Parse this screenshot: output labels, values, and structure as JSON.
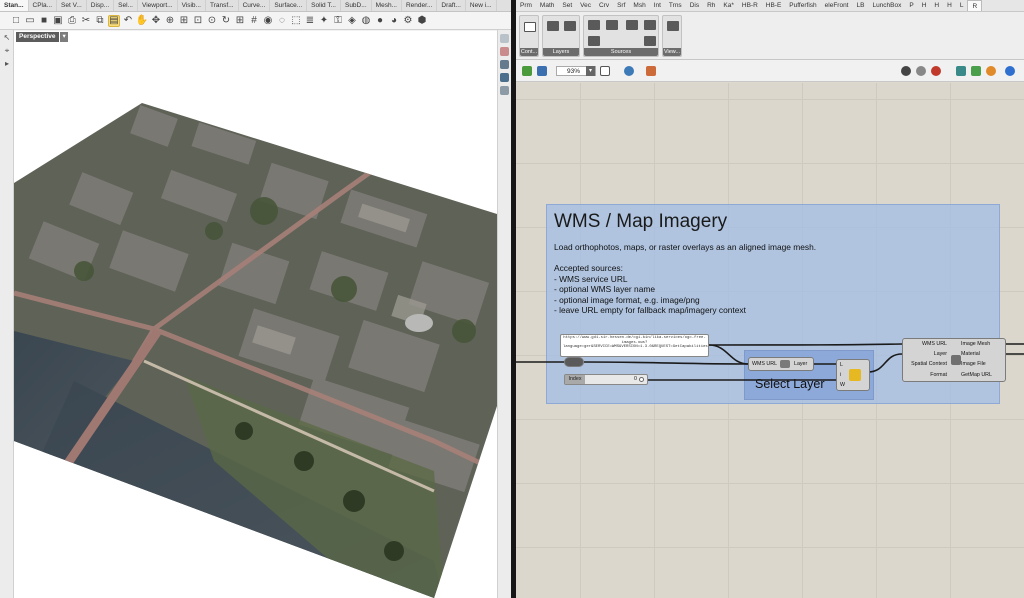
{
  "rhino": {
    "tabs": [
      "Stan...",
      "CPla...",
      "Set V...",
      "Disp...",
      "Sel...",
      "Viewport...",
      "Visib...",
      "Transf...",
      "Curve...",
      "Surface...",
      "Solid T...",
      "SubD...",
      "Mesh...",
      "Render...",
      "Draft...",
      "New i..."
    ],
    "active_tab": 0,
    "toolbar_icons": [
      "new-file-icon",
      "open-folder-icon",
      "save-icon",
      "print-icon",
      "import-icon",
      "cut-icon",
      "copy-icon",
      "paste-icon",
      "undo-icon",
      "pan-hand-icon",
      "move-icon",
      "zoom-icon",
      "zoom-window-icon",
      "zoom-extents-icon",
      "zoom-selected-icon",
      "rotate-view-icon",
      "four-viewports-icon",
      "grid-icon",
      "camera-icon",
      "hide-icon",
      "select-objects-icon",
      "layer-icon",
      "light-icon",
      "lock-icon",
      "material-icon",
      "color-wheel-icon",
      "render-sphere-icon",
      "shaded-sphere-icon",
      "settings-gear-icon",
      "plugin-icon"
    ],
    "viewport_label": "Perspective",
    "viewport_dropdown": "▾"
  },
  "grasshopper": {
    "tabs": [
      "Prm",
      "Math",
      "Set",
      "Vec",
      "Crv",
      "Srf",
      "Msh",
      "Int",
      "Trns",
      "Dis",
      "Rh",
      "Ka*",
      "HB-R",
      "HB-E",
      "Pufferfish",
      "eleFront",
      "LB",
      "LunchBox",
      "P",
      "H",
      "H",
      "H",
      "L",
      "R"
    ],
    "active_tab_index": 23,
    "ribbon_groups": [
      "Cont...",
      "Layers",
      "Sources",
      "View..."
    ],
    "zoom": "93%",
    "group": {
      "title": "WMS / Map Imagery",
      "description": [
        "Load orthophotos, maps, or raster overlays as an aligned image mesh.",
        "",
        "Accepted sources:",
        "- WMS service URL",
        "- optional WMS layer name",
        "- optional image format, e.g. image/png",
        "- leave URL empty for fallback map/imagery context"
      ]
    },
    "url_panel_text": "https://www.gdi-sir.hessen.de/cgi-bin/lika-services/ogc-free-images.ows?language=ger&SERVICE=WMS&VERSION=1.3.0&REQUEST=GetCapabilities",
    "index_slider": {
      "label": "Index",
      "value": "0"
    },
    "layer_node": {
      "input": "WMS URL",
      "output": "Layer"
    },
    "select_node": {
      "inputs": [
        "L",
        "i",
        "W"
      ]
    },
    "select_layer_label": "Select Layer",
    "main_component": {
      "inputs": [
        "WMS URL",
        "Layer",
        "Spatial Context",
        "Format"
      ],
      "outputs": [
        "Image Mesh",
        "Material",
        "Image File",
        "GetMap URL"
      ]
    },
    "colors": {
      "group_fill": "#a0bce8",
      "canvas": "#dcd7cd",
      "wire": "#1b1b1b"
    }
  }
}
